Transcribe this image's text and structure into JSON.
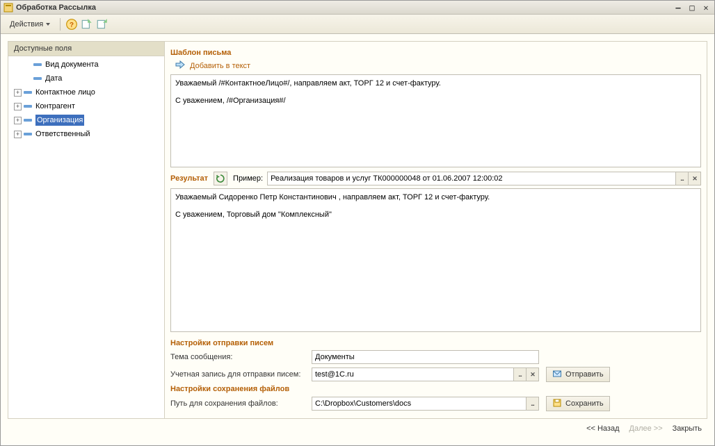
{
  "window": {
    "title": "Обработка  Рассылка"
  },
  "toolbar": {
    "actions_label": "Действия"
  },
  "sidebar": {
    "header": "Доступные поля",
    "items": [
      {
        "label": "Вид документа",
        "expandable": false
      },
      {
        "label": "Дата",
        "expandable": false
      },
      {
        "label": "Контактное лицо",
        "expandable": true
      },
      {
        "label": "Контрагент",
        "expandable": true
      },
      {
        "label": "Организация",
        "expandable": true,
        "selected": true
      },
      {
        "label": "Ответственный",
        "expandable": true
      }
    ]
  },
  "template": {
    "title": "Шаблон письма",
    "add_label": "Добавить в текст",
    "body_line1": "Уважаемый /#КонтактноеЛицо#/, направляем акт, ТОРГ 12 и счет-фактуру.",
    "body_line2": "С уважением, /#Организация#/"
  },
  "result": {
    "title": "Результат",
    "example_label": "Пример:",
    "example_value": "Реализация товаров и услуг ТК000000048 от 01.06.2007 12:00:02",
    "body_line1": "Уважаемый Сидоренко Петр Константинович , направляем акт, ТОРГ 12 и счет-фактуру.",
    "body_line2": "С уважением, Торговый дом \"Комплексный\""
  },
  "send_settings": {
    "title": "Настройки отправки писем",
    "subject_label": "Тема сообщения:",
    "subject_value": "Документы",
    "account_label": "Учетная запись для отправки писем:",
    "account_value": "test@1C.ru",
    "send_btn": "Отправить"
  },
  "save_settings": {
    "title": "Настройки сохранения файлов",
    "path_label": "Путь для сохранения файлов:",
    "path_value": "C:\\Dropbox\\Customers\\docs",
    "save_btn": "Сохранить"
  },
  "footer": {
    "back": "<< Назад",
    "next": "Далее >>",
    "close": "Закрыть"
  }
}
